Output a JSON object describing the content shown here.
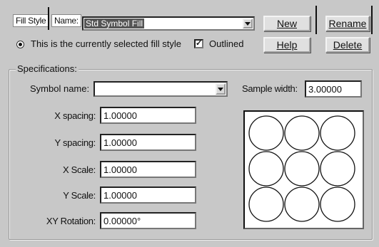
{
  "header": {
    "fill_style_label": "Fill Style",
    "name_label": "Name:",
    "name_value": "Std Symbol Fill"
  },
  "buttons": {
    "new": "New",
    "rename": "Rename",
    "help": "Help",
    "delete": "Delete"
  },
  "status": {
    "current_text": "This is the currently selected fill style",
    "outlined_label": "Outlined",
    "outlined_checked": true
  },
  "specifications": {
    "title": "Specifications:",
    "symbol_name_label": "Symbol name:",
    "symbol_name_value": "",
    "sample_width_label": "Sample width:",
    "sample_width_value": "3.00000",
    "fields": [
      {
        "label": "X spacing:",
        "value": "1.00000"
      },
      {
        "label": "Y spacing:",
        "value": "1.00000"
      },
      {
        "label": "X Scale:",
        "value": "1.00000"
      },
      {
        "label": "Y Scale:",
        "value": "1.00000"
      },
      {
        "label": "XY Rotation:",
        "value": "0.00000°"
      }
    ]
  },
  "icons": {
    "radio": "radio-selected-icon",
    "check": "checkmark-icon",
    "dropdown": "chevron-down-icon"
  }
}
